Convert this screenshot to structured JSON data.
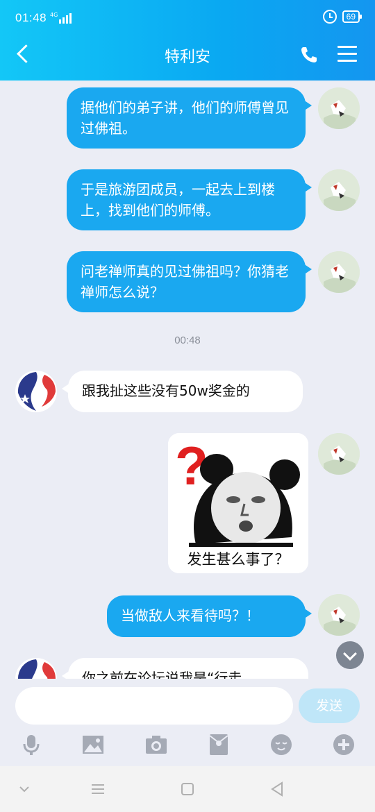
{
  "status": {
    "time": "01:48",
    "network": "4G",
    "battery": "69"
  },
  "header": {
    "title": "特利安"
  },
  "messages": [
    {
      "from": "self",
      "text": "据他们的弟子讲，他们的师傅曾见过佛祖。"
    },
    {
      "from": "self",
      "text": "于是旅游团成员，一起去上到楼上，找到他们的师傅。"
    },
    {
      "from": "self",
      "text": "问老禅师真的见过佛祖吗？你猜老禅师怎么说？"
    },
    {
      "from": "other",
      "text": "跟我扯这些没有50w奖金的"
    },
    {
      "from": "self",
      "sticker_caption": "发生甚么事了？"
    },
    {
      "from": "self",
      "text": "当做敌人来看待吗？！"
    },
    {
      "from": "other",
      "text": "你之前在论坛说我是“行走"
    }
  ],
  "timestamp": "00:48",
  "input": {
    "placeholder": "",
    "send_label": "发送"
  },
  "toolbar_icons": [
    "microphone-icon",
    "image-icon",
    "camera-icon",
    "red-packet-icon",
    "emoji-icon",
    "plus-icon"
  ],
  "colors": {
    "header": "#0aa8f2",
    "bubble_self": "#1aa8f0",
    "background": "#ebedf5"
  }
}
